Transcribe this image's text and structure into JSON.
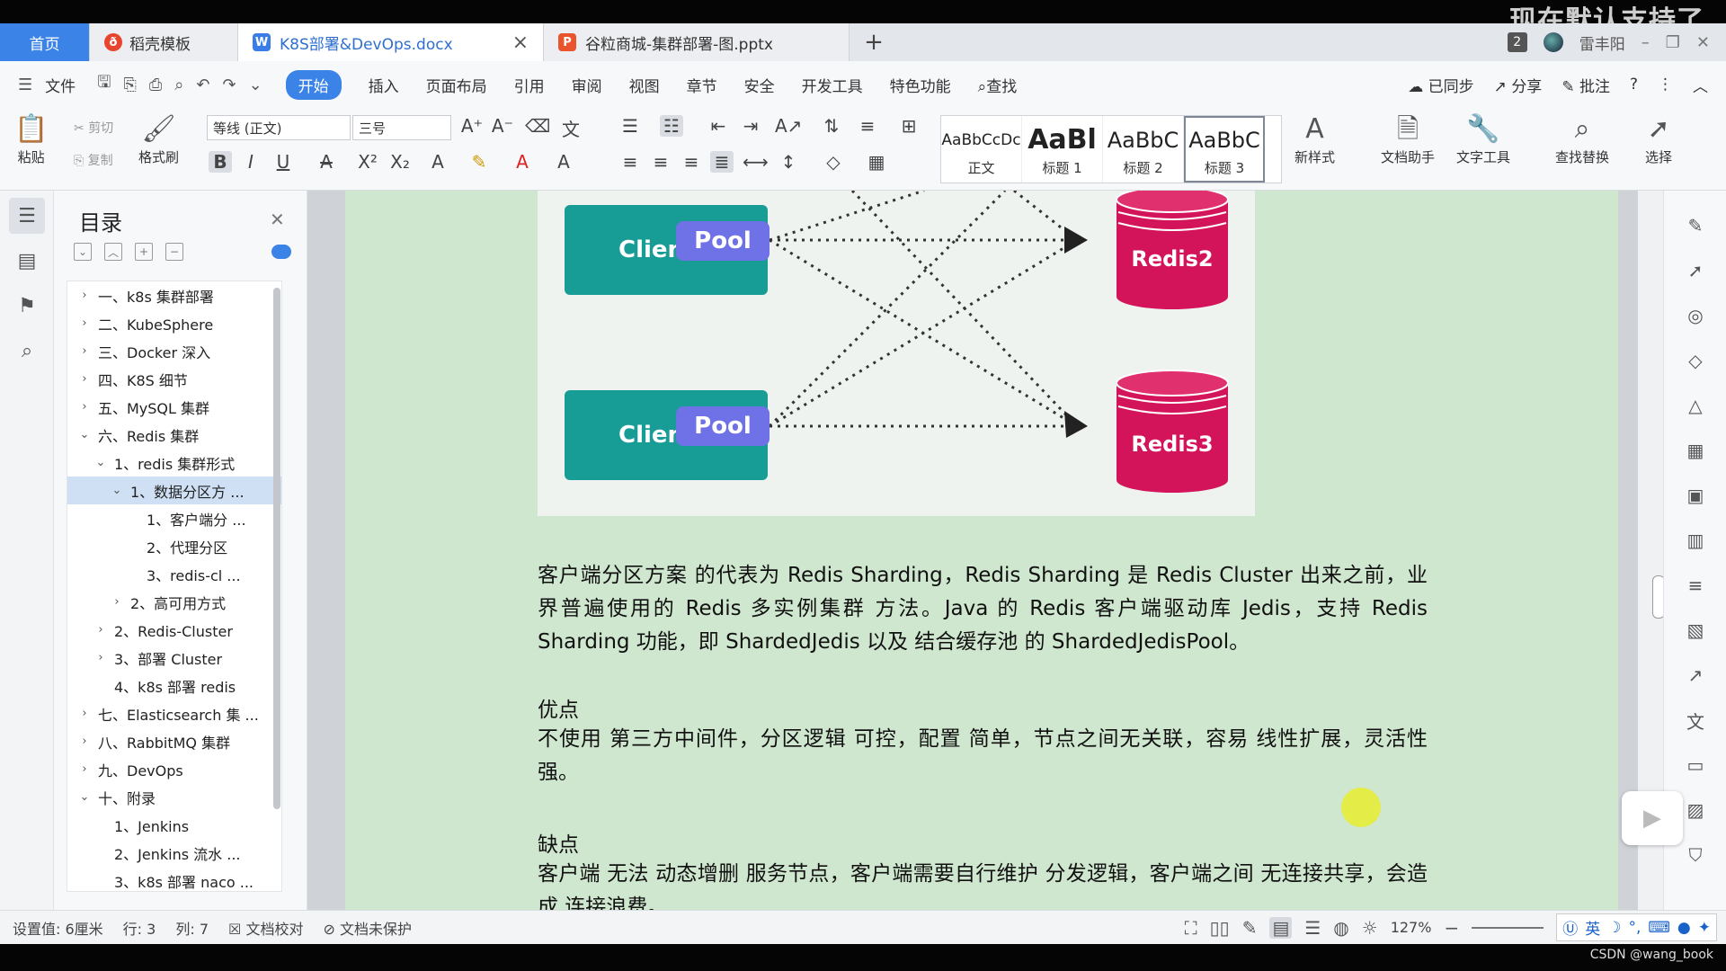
{
  "watermark": "现在默认支持了",
  "tabs": {
    "home": "首页",
    "docer": "稻壳模板",
    "doc": "K8S部署&DevOps.docx",
    "ppt": "谷粒商城-集群部署-图.pptx",
    "new_tab": "+",
    "window_count": "2",
    "user": "雷丰阳"
  },
  "menu": {
    "file": "文件",
    "items": [
      "开始",
      "插入",
      "页面布局",
      "引用",
      "审阅",
      "视图",
      "章节",
      "安全",
      "开发工具",
      "特色功能"
    ],
    "search": "查找",
    "synced": "已同步",
    "share": "分享",
    "comment": "批注"
  },
  "ribbon": {
    "paste": "粘贴",
    "cut": "剪切",
    "copy": "复制",
    "format_painter": "格式刷",
    "font_name": "等线 (正文)",
    "font_size": "三号",
    "styles": [
      {
        "preview": "AaBbCcDc",
        "label": "正文"
      },
      {
        "preview": "AaBl",
        "label": "标题 1"
      },
      {
        "preview": "AaBbC",
        "label": "标题 2"
      },
      {
        "preview": "AaBbC",
        "label": "标题 3"
      }
    ],
    "new_style": "新样式",
    "doc_assistant": "文档助手",
    "text_tools": "文字工具",
    "find_replace": "查找替换",
    "select": "选择"
  },
  "toc": {
    "title": "目录",
    "items": [
      {
        "text": "一、k8s 集群部署",
        "level": 0,
        "chev": "›"
      },
      {
        "text": "二、KubeSphere",
        "level": 0,
        "chev": "›"
      },
      {
        "text": "三、Docker 深入",
        "level": 0,
        "chev": "›"
      },
      {
        "text": "四、K8S 细节",
        "level": 0,
        "chev": "›"
      },
      {
        "text": "五、MySQL 集群",
        "level": 0,
        "chev": "›"
      },
      {
        "text": "六、Redis 集群",
        "level": 0,
        "chev": "⌄"
      },
      {
        "text": "1、redis 集群形式",
        "level": 1,
        "chev": "⌄"
      },
      {
        "text": "1、数据分区方 ...",
        "level": 2,
        "chev": "⌄",
        "active": true
      },
      {
        "text": "1、客户端分 ...",
        "level": 3,
        "chev": ""
      },
      {
        "text": "2、代理分区",
        "level": 3,
        "chev": ""
      },
      {
        "text": "3、redis-cl ...",
        "level": 3,
        "chev": ""
      },
      {
        "text": "2、高可用方式",
        "level": 2,
        "chev": "›"
      },
      {
        "text": "2、Redis-Cluster",
        "level": 1,
        "chev": "›"
      },
      {
        "text": "3、部署 Cluster",
        "level": 1,
        "chev": "›"
      },
      {
        "text": "4、k8s 部署 redis",
        "level": 1,
        "chev": ""
      },
      {
        "text": "七、Elasticsearch 集 ...",
        "level": 0,
        "chev": "›"
      },
      {
        "text": "八、RabbitMQ 集群",
        "level": 0,
        "chev": "›"
      },
      {
        "text": "九、DevOps",
        "level": 0,
        "chev": "›"
      },
      {
        "text": "十、附录",
        "level": 0,
        "chev": "⌄"
      },
      {
        "text": "1、Jenkins",
        "level": 1,
        "chev": ""
      },
      {
        "text": "2、Jenkins 流水 ...",
        "level": 1,
        "chev": ""
      },
      {
        "text": "3、k8s 部署 naco ...",
        "level": 1,
        "chev": ""
      }
    ]
  },
  "diagram": {
    "clients": [
      "Client2",
      "Client3"
    ],
    "pool": "Pool",
    "redis": [
      "Redis2",
      "Redis3"
    ],
    "colors": {
      "client": "#179c96",
      "pool": "#6e72e6",
      "redis": "#d4145a"
    }
  },
  "doc": {
    "para1": "客户端分区方案 的代表为 Redis Sharding，Redis Sharding 是 Redis Cluster 出来之前，业界普遍使用的 Redis 多实例集群 方法。Java 的 Redis 客户端驱动库 Jedis，支持 Redis Sharding 功能，即 ShardedJedis 以及 结合缓存池 的 ShardedJedisPool。",
    "pros_heading": "优点",
    "pros": "不使用 第三方中间件，分区逻辑 可控，配置 简单，节点之间无关联，容易 线性扩展，灵活性强。",
    "cons_heading": "缺点",
    "cons": "客户端 无法 动态增删 服务节点，客户端需要自行维护 分发逻辑，客户端之间 无连接共享，会造成 连接浪费。"
  },
  "status": {
    "setting": "设置值: 6厘米",
    "row": "行: 3",
    "col": "列: 7",
    "proofread": "文档校对",
    "unprotected": "文档未保护",
    "zoom": "127%",
    "ime_lang": "英"
  },
  "footer": {
    "csdn": "CSDN @wang_book"
  }
}
